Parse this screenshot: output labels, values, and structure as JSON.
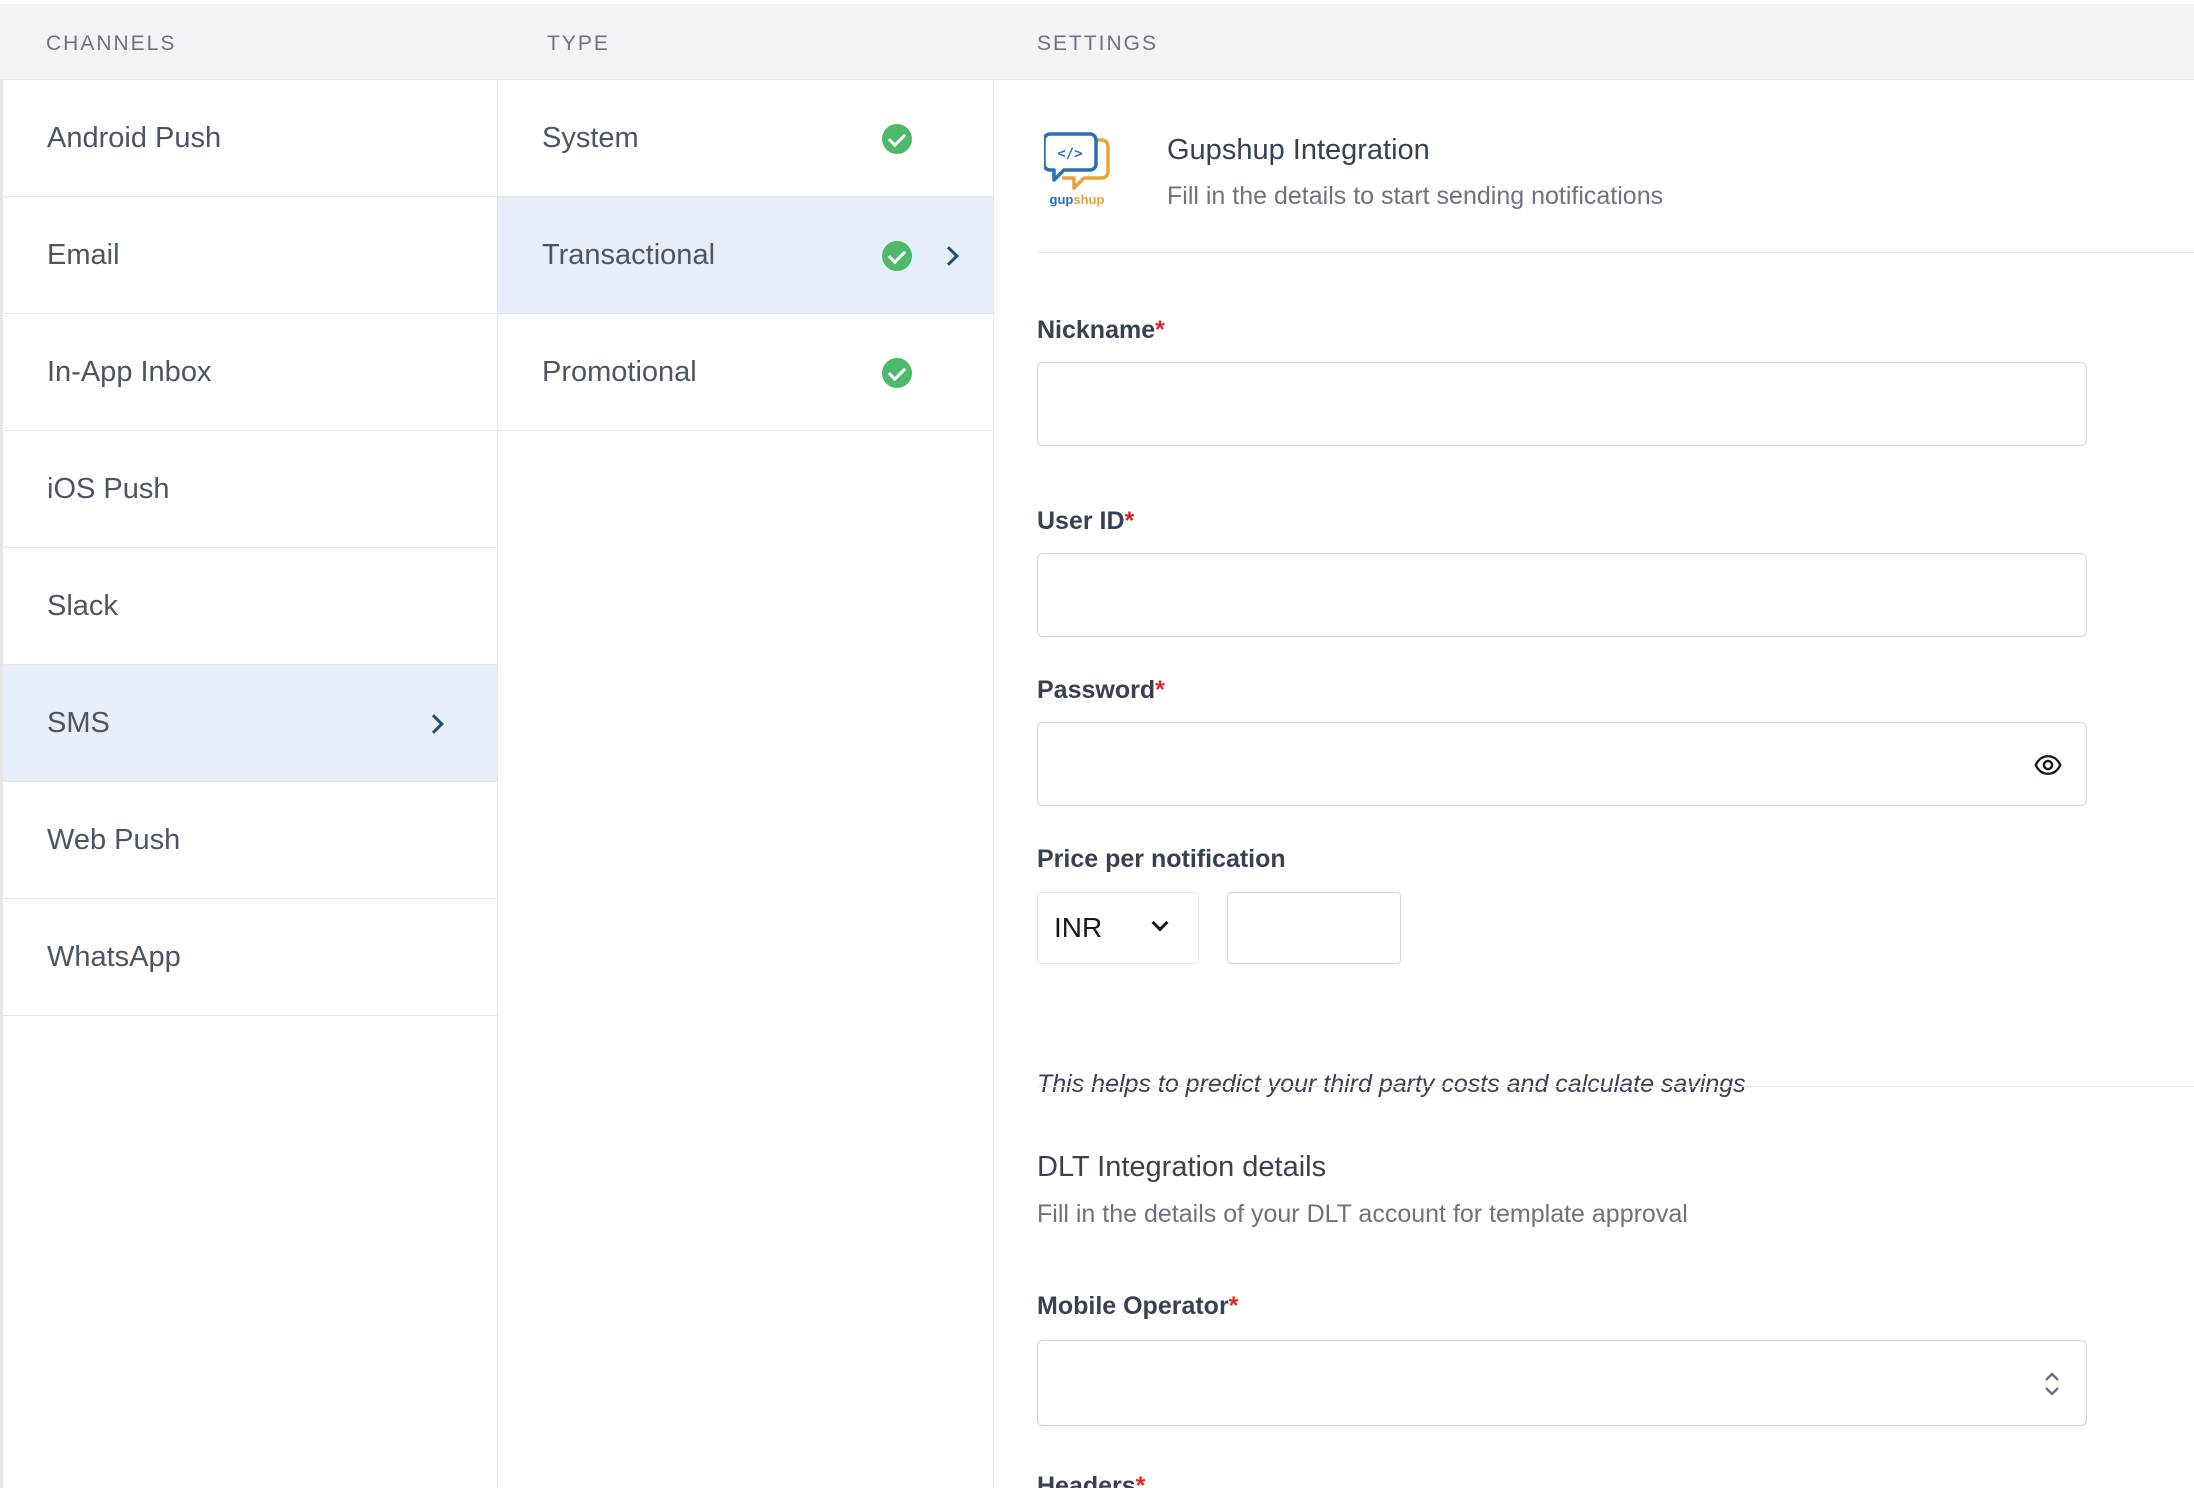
{
  "headers": {
    "channels": "CHANNELS",
    "type": "TYPE",
    "settings": "SETTINGS"
  },
  "channels": [
    {
      "label": "Android Push"
    },
    {
      "label": "Email"
    },
    {
      "label": "In-App Inbox"
    },
    {
      "label": "iOS Push"
    },
    {
      "label": "Slack"
    },
    {
      "label": "SMS",
      "active": true
    },
    {
      "label": "Web Push"
    },
    {
      "label": "WhatsApp"
    }
  ],
  "types": [
    {
      "label": "System",
      "status": "check-circle-icon"
    },
    {
      "label": "Transactional",
      "status": "check-circle-icon",
      "active": true
    },
    {
      "label": "Promotional",
      "status": "check-circle-icon"
    }
  ],
  "settings": {
    "logo_text": "gupshup",
    "title": "Gupshup Integration",
    "subtitle": "Fill in the details to start sending notifications",
    "nickname_label": "Nickname",
    "user_id_label": "User ID",
    "password_label": "Password",
    "required_mark": "*",
    "price_label": "Price per notification",
    "currency": "INR",
    "price_hint": "This helps to predict your third party costs and calculate savings",
    "dlt_title": "DLT Integration details",
    "dlt_subtitle": "Fill in the details of your DLT account for template approval",
    "mobile_operator_label": "Mobile Operator",
    "headers_label": "Headers"
  },
  "colors": {
    "active_row": "#e6eef9",
    "check": "#4cba6a",
    "required": "#dc2626"
  }
}
